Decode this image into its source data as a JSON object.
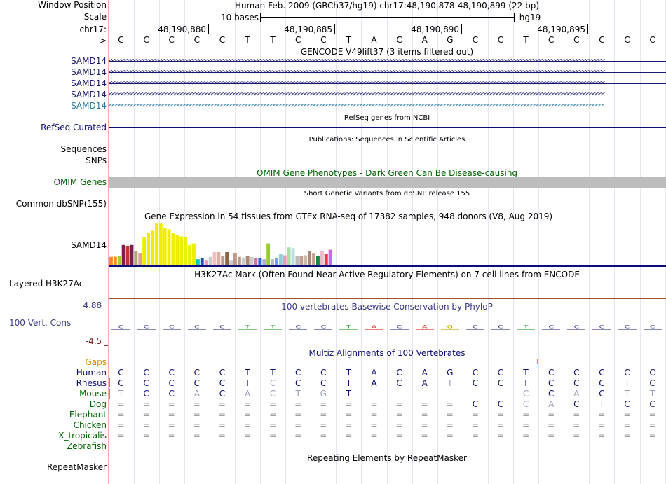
{
  "header": {
    "window_position_label": "Window Position",
    "scale_label": "Scale",
    "chrom_label": "chr17:",
    "arrow_label": "--->",
    "assembly_text": "Human Feb. 2009 (GRCh37/hg19)   chr17:48,190,878-48,190,899 (22 bp)",
    "scale_text": "10 bases",
    "scale_db": "hg19",
    "ruler_ticks": [
      {
        "label": "48,190,880",
        "at": 3
      },
      {
        "label": "48,190,885",
        "at": 8
      },
      {
        "label": "48,190,890",
        "at": 13
      },
      {
        "label": "48,190,895",
        "at": 18
      }
    ]
  },
  "sequence": [
    "C",
    "C",
    "C",
    "C",
    "C",
    "T",
    "T",
    "C",
    "C",
    "T",
    "A",
    "C",
    "A",
    "G",
    "C",
    "C",
    "T",
    "C",
    "C",
    "C",
    "C",
    "C"
  ],
  "tracks": {
    "gencode": {
      "title": "GENCODE V49lift37 (3 items filtered out)",
      "genes": [
        {
          "label": "SAMD14",
          "color": "#191970"
        },
        {
          "label": "SAMD14",
          "color": "#191970"
        },
        {
          "label": "SAMD14",
          "color": "#191970"
        },
        {
          "label": "SAMD14",
          "color": "#191970"
        },
        {
          "label": "SAMD14",
          "color": "#2a7aa6"
        }
      ]
    },
    "refseq": {
      "title": "RefSeq genes from NCBI",
      "label": "RefSeq Curated",
      "color": "#0c0c78"
    },
    "publications": {
      "title": "Publications: Sequences in Scientific Articles",
      "labels": [
        "Sequences",
        "SNPs"
      ]
    },
    "omim": {
      "title": "OMIM Gene Phenotypes - Dark Green Can Be Disease-causing",
      "label": "OMIM Genes",
      "color": "#006400"
    },
    "dbsnp": {
      "title": "Short Genetic Variants from dbSNP release 155",
      "label": "Common dbSNP(155)"
    },
    "gtex": {
      "title": "Gene Expression in 54 tissues from GTEx RNA-seq of 17382 samples, 948 donors (V8, Aug 2019)",
      "label": "SAMD14",
      "values": [
        10,
        10,
        11,
        25,
        24,
        25,
        17,
        15,
        35,
        40,
        43,
        52,
        52,
        46,
        45,
        40,
        38,
        36,
        35,
        25,
        27,
        7,
        8,
        6,
        10,
        16,
        16,
        11,
        16,
        6,
        15,
        10,
        9,
        11,
        10,
        8,
        8,
        7,
        27,
        7,
        8,
        14,
        12,
        22,
        21,
        11,
        11,
        12,
        17,
        15,
        11,
        18,
        14,
        19
      ],
      "colors": [
        "#ff8c1a",
        "#ff8c1a",
        "#aacc33",
        "#7a1f4f",
        "#c73333",
        "#7a1f4f",
        "#b3a17a",
        "#dda0a0",
        "#eeee00",
        "#eeee00",
        "#eeee00",
        "#eeee00",
        "#eeee00",
        "#eeee00",
        "#eeee00",
        "#eeee00",
        "#eeee00",
        "#eeee00",
        "#eeee00",
        "#eeee00",
        "#eeee00",
        "#00c8c8",
        "#2255aa",
        "#ee99bb",
        "#cccccc",
        "#f0c0c0",
        "#ddb0a0",
        "#bb9988",
        "#886644",
        "#cccccc",
        "#bb9988",
        "#bb9988",
        "#cccccc",
        "#aa8877",
        "#cccccc",
        "#cc77aa",
        "#3366dd",
        "#b0b0e0",
        "#99cc33",
        "#bbbbbb",
        "#7799ff",
        "#99ccdd",
        "#ee99bb",
        "#aaddaa",
        "#bbdddd",
        "#bbbbbb",
        "#c2a090",
        "#ccbbaa",
        "#aa8877",
        "#c2a090",
        "#118844",
        "#eebbcc",
        "#ee3344",
        "#cc66ee"
      ],
      "ymax": 55
    },
    "h3k27ac": {
      "title": "H3K27Ac Mark (Often Found Near Active Regulatory Elements) on 7 cell lines from ENCODE",
      "label": "Layered H3K27Ac"
    },
    "conservation": {
      "title": "100 vertebrates Basewise Conservation by PhyloP",
      "label": "100 Vert. Cons",
      "ymax_label": "4.88 _",
      "ymin_label": "-4.5 _",
      "color": "#3a3a8c"
    },
    "multiz": {
      "title": "Multiz Alignments of 100 Vertebrates",
      "gaps_label": "Gaps",
      "gap_marks": [
        "1",
        "1"
      ],
      "species": [
        {
          "name": "Human",
          "color": "#0c0c78",
          "bases": [
            "C",
            "C",
            "C",
            "C",
            "C",
            "T",
            "T",
            "C",
            "C",
            "T",
            "A",
            "C",
            "A",
            "G",
            "C",
            "C",
            "T",
            "C",
            "C",
            "C",
            "C",
            "C"
          ]
        },
        {
          "name": "Rhesus",
          "color": "#0c0c78",
          "bases": [
            "C",
            "C",
            "C",
            "C",
            "C",
            "T",
            "C",
            "C",
            "C",
            "T",
            "A",
            "C",
            "A",
            "T",
            "C",
            "C",
            "T",
            "C",
            "C",
            "C",
            "T",
            "C"
          ]
        },
        {
          "name": "Mouse",
          "color": "#006400",
          "bases": [
            "T",
            "C",
            "C",
            "A",
            "C",
            "A",
            "C",
            "T",
            "G",
            "T",
            "-",
            "-",
            "-",
            "-",
            "-",
            "-",
            "C",
            "C",
            "A",
            "C",
            "T",
            "T"
          ]
        },
        {
          "name": "Dog",
          "color": "#006400",
          "bases": [
            "=",
            "=",
            "=",
            "=",
            "=",
            "=",
            "=",
            "=",
            "=",
            "=",
            "=",
            "=",
            "=",
            "=",
            "C",
            "C",
            "C",
            "A",
            "C",
            "T",
            "C",
            "C"
          ]
        },
        {
          "name": "Elephant",
          "color": "#006400",
          "bases": [
            "=",
            "=",
            "=",
            "=",
            "=",
            "=",
            "=",
            "=",
            "=",
            "=",
            "=",
            "=",
            "=",
            "=",
            "=",
            "=",
            "=",
            "=",
            "=",
            "=",
            "=",
            "="
          ]
        },
        {
          "name": "Chicken",
          "color": "#006400",
          "bases": [
            "=",
            "=",
            "=",
            "=",
            "=",
            "=",
            "=",
            "=",
            "=",
            "=",
            "=",
            "=",
            "=",
            "=",
            "=",
            "=",
            "=",
            "=",
            "=",
            "=",
            "=",
            "="
          ]
        },
        {
          "name": "X_tropicalis",
          "color": "#006400",
          "bases": [
            "=",
            "=",
            "=",
            "=",
            "=",
            "=",
            "=",
            "=",
            "=",
            "=",
            "=",
            "=",
            "=",
            "=",
            "=",
            "=",
            "=",
            "=",
            "=",
            "=",
            "=",
            "="
          ]
        },
        {
          "name": "Zebrafish",
          "color": "#006400",
          "bases": []
        }
      ]
    },
    "repeatmasker": {
      "title": "Repeating Elements by RepeatMasker",
      "label": "RepeatMasker"
    }
  }
}
